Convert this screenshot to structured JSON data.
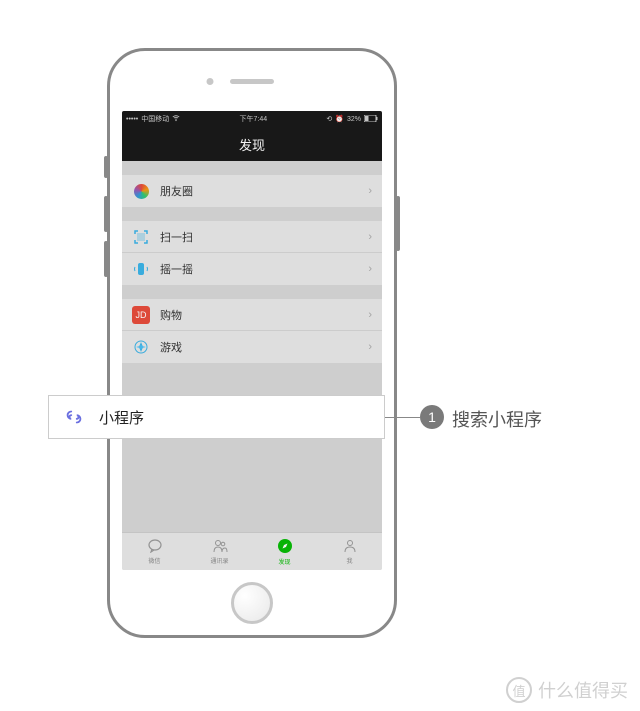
{
  "status_bar": {
    "carrier": "中国移动",
    "signal_icon": "•••••",
    "wifi_icon": "wifi",
    "time": "下午7:44",
    "battery_pct": "32%",
    "alarm_icon": "alarm"
  },
  "nav": {
    "title": "发现"
  },
  "groups": [
    {
      "rows": [
        {
          "icon": "moments",
          "label": "朋友圈"
        }
      ]
    },
    {
      "rows": [
        {
          "icon": "scan",
          "label": "扫一扫"
        },
        {
          "icon": "shake",
          "label": "摇一摇"
        }
      ]
    },
    {
      "rows": [
        {
          "icon": "shop",
          "label": "购物"
        },
        {
          "icon": "game",
          "label": "游戏"
        }
      ]
    }
  ],
  "callout": {
    "row": {
      "icon": "miniprogram",
      "label": "小程序"
    },
    "step_number": "1",
    "step_text": "搜索小程序"
  },
  "tabs": [
    {
      "icon": "chat",
      "label": "微信",
      "active": false
    },
    {
      "icon": "contacts",
      "label": "通讯录",
      "active": false
    },
    {
      "icon": "discover",
      "label": "发现",
      "active": true
    },
    {
      "icon": "me",
      "label": "我",
      "active": false
    }
  ],
  "watermark": {
    "badge": "值",
    "text": "什么值得买"
  }
}
